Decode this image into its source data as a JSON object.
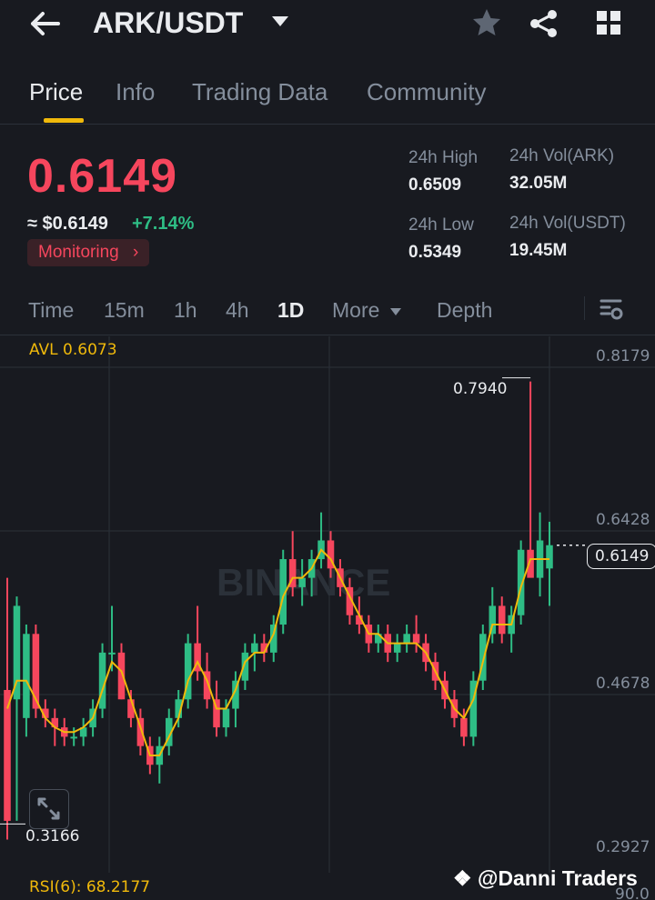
{
  "header": {
    "title": "ARK/USDT",
    "back_icon": "arrow-left-icon",
    "dropdown_icon": "caret-down-icon",
    "star_icon": "star-icon",
    "share_icon": "share-icon",
    "grid_icon": "grid-icon"
  },
  "tabs": [
    {
      "label": "Price",
      "active": true
    },
    {
      "label": "Info",
      "active": false
    },
    {
      "label": "Trading Data",
      "active": false
    },
    {
      "label": "Community",
      "active": false
    }
  ],
  "price": {
    "last": "0.6149",
    "usd": "≈ $0.6149",
    "change": "+7.14%",
    "monitoring": "Monitoring",
    "monitoring_chevron": "›"
  },
  "stats": {
    "high_label": "24h High",
    "high_value": "0.6509",
    "low_label": "24h Low",
    "low_value": "0.5349",
    "vol_ark_label": "24h Vol(ARK)",
    "vol_ark_value": "32.05M",
    "vol_usdt_label": "24h Vol(USDT)",
    "vol_usdt_value": "19.45M"
  },
  "timeframes": [
    {
      "label": "Time",
      "active": false
    },
    {
      "label": "15m",
      "active": false
    },
    {
      "label": "1h",
      "active": false
    },
    {
      "label": "4h",
      "active": false
    },
    {
      "label": "1D",
      "active": true
    },
    {
      "label": "More",
      "active": false
    },
    {
      "label": "Depth",
      "active": false
    }
  ],
  "chart_settings_icon": "chart-settings-icon",
  "chart": {
    "avl_label": "AVL 0.6073",
    "y_ticks": [
      "0.8179",
      "0.6428",
      "0.4678",
      "0.2927"
    ],
    "current_price_tag": "0.6149",
    "high_marker": "0.7940",
    "low_marker": "0.3166",
    "watermark": "BINANCE",
    "rsi_label": "RSI(6): 68.2177",
    "rsi_axis": "90.0",
    "expand_icon": "expand-icon",
    "credit": "@Danni Traders"
  },
  "colors": {
    "up": "#2ebd85",
    "down": "#f6465d",
    "ma": "#f0b90b",
    "accent": "#f0b90b"
  },
  "chart_data": {
    "type": "candlestick",
    "ylim": [
      0.2927,
      0.8179
    ],
    "candles": [
      [
        0.46,
        0.58,
        0.3,
        0.32
      ],
      [
        0.45,
        0.56,
        0.32,
        0.55
      ],
      [
        0.43,
        0.53,
        0.41,
        0.52
      ],
      [
        0.52,
        0.53,
        0.43,
        0.44
      ],
      [
        0.44,
        0.45,
        0.42,
        0.43
      ],
      [
        0.43,
        0.44,
        0.4,
        0.42
      ],
      [
        0.42,
        0.43,
        0.4,
        0.41
      ],
      [
        0.41,
        0.42,
        0.4,
        0.41
      ],
      [
        0.41,
        0.43,
        0.4,
        0.42
      ],
      [
        0.42,
        0.45,
        0.41,
        0.44
      ],
      [
        0.44,
        0.51,
        0.43,
        0.5
      ],
      [
        0.5,
        0.55,
        0.48,
        0.5
      ],
      [
        0.5,
        0.51,
        0.45,
        0.45
      ],
      [
        0.45,
        0.46,
        0.42,
        0.43
      ],
      [
        0.43,
        0.44,
        0.39,
        0.4
      ],
      [
        0.4,
        0.41,
        0.37,
        0.38
      ],
      [
        0.38,
        0.41,
        0.36,
        0.4
      ],
      [
        0.4,
        0.44,
        0.39,
        0.43
      ],
      [
        0.43,
        0.46,
        0.42,
        0.45
      ],
      [
        0.45,
        0.52,
        0.44,
        0.51
      ],
      [
        0.51,
        0.55,
        0.47,
        0.48
      ],
      [
        0.48,
        0.5,
        0.44,
        0.45
      ],
      [
        0.45,
        0.47,
        0.41,
        0.42
      ],
      [
        0.42,
        0.45,
        0.41,
        0.44
      ],
      [
        0.44,
        0.48,
        0.42,
        0.47
      ],
      [
        0.47,
        0.51,
        0.46,
        0.5
      ],
      [
        0.5,
        0.52,
        0.48,
        0.51
      ],
      [
        0.51,
        0.52,
        0.49,
        0.5
      ],
      [
        0.5,
        0.54,
        0.49,
        0.53
      ],
      [
        0.53,
        0.61,
        0.52,
        0.6
      ],
      [
        0.6,
        0.63,
        0.56,
        0.57
      ],
      [
        0.57,
        0.6,
        0.55,
        0.58
      ],
      [
        0.58,
        0.61,
        0.56,
        0.6
      ],
      [
        0.6,
        0.65,
        0.59,
        0.62
      ],
      [
        0.62,
        0.63,
        0.58,
        0.59
      ],
      [
        0.59,
        0.6,
        0.56,
        0.57
      ],
      [
        0.57,
        0.58,
        0.53,
        0.54
      ],
      [
        0.54,
        0.56,
        0.52,
        0.53
      ],
      [
        0.53,
        0.54,
        0.5,
        0.51
      ],
      [
        0.51,
        0.53,
        0.5,
        0.52
      ],
      [
        0.52,
        0.53,
        0.49,
        0.5
      ],
      [
        0.5,
        0.52,
        0.49,
        0.51
      ],
      [
        0.51,
        0.53,
        0.5,
        0.52
      ],
      [
        0.52,
        0.54,
        0.5,
        0.51
      ],
      [
        0.51,
        0.52,
        0.48,
        0.49
      ],
      [
        0.49,
        0.5,
        0.46,
        0.47
      ],
      [
        0.47,
        0.48,
        0.44,
        0.45
      ],
      [
        0.45,
        0.46,
        0.42,
        0.43
      ],
      [
        0.43,
        0.44,
        0.4,
        0.41
      ],
      [
        0.41,
        0.48,
        0.4,
        0.47
      ],
      [
        0.47,
        0.53,
        0.46,
        0.52
      ],
      [
        0.52,
        0.57,
        0.51,
        0.55
      ],
      [
        0.55,
        0.56,
        0.51,
        0.52
      ],
      [
        0.52,
        0.55,
        0.5,
        0.54
      ],
      [
        0.54,
        0.62,
        0.53,
        0.61
      ],
      [
        0.61,
        0.79,
        0.6,
        0.58
      ],
      [
        0.58,
        0.65,
        0.56,
        0.62
      ],
      [
        0.59,
        0.64,
        0.55,
        0.6149
      ]
    ],
    "ma": [
      0.44,
      0.47,
      0.47,
      0.45,
      0.43,
      0.42,
      0.415,
      0.415,
      0.42,
      0.43,
      0.46,
      0.49,
      0.48,
      0.45,
      0.42,
      0.39,
      0.39,
      0.41,
      0.43,
      0.47,
      0.49,
      0.47,
      0.44,
      0.44,
      0.46,
      0.49,
      0.5,
      0.5,
      0.52,
      0.56,
      0.58,
      0.58,
      0.59,
      0.61,
      0.6,
      0.58,
      0.56,
      0.54,
      0.52,
      0.52,
      0.51,
      0.51,
      0.51,
      0.51,
      0.5,
      0.48,
      0.46,
      0.44,
      0.43,
      0.45,
      0.49,
      0.53,
      0.53,
      0.53,
      0.57,
      0.6,
      0.6,
      0.6
    ]
  }
}
